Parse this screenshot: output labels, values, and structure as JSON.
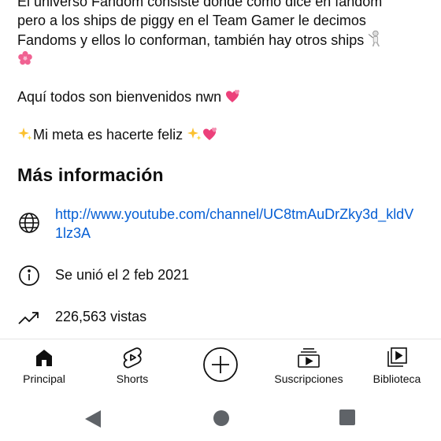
{
  "description": {
    "line1": "El universo Fandom consiste dónde como dice en fandom",
    "line2": "pero a los ships de piggy en el Team Gamer le decimos",
    "line3": "Fandoms y ellos lo conforman, también hay otros ships",
    "line4": "Aquí todos son bienvenidos nwn",
    "line5": "Mi meta es hacerte feliz"
  },
  "more_info": {
    "title": "Más información",
    "link": "http://www.youtube.com/channel/UC8tmAuDrZky3d_kldV1lz3A",
    "joined": "Se unió el 2 feb 2021",
    "views": "226,563 vistas"
  },
  "nav": {
    "items": [
      {
        "label": "Principal",
        "icon": "home-icon"
      },
      {
        "label": "Shorts",
        "icon": "shorts-icon"
      },
      {
        "label": "",
        "icon": "create-icon"
      },
      {
        "label": "Suscripciones",
        "icon": "subscriptions-icon"
      },
      {
        "label": "Biblioteca",
        "icon": "library-icon"
      }
    ]
  },
  "system_nav": {
    "icons": [
      "back-icon",
      "home-circle-icon",
      "recents-icon"
    ]
  },
  "colors": {
    "link": "#065fd4",
    "text": "#0f0f0f",
    "system_icons": "#5f6368"
  }
}
